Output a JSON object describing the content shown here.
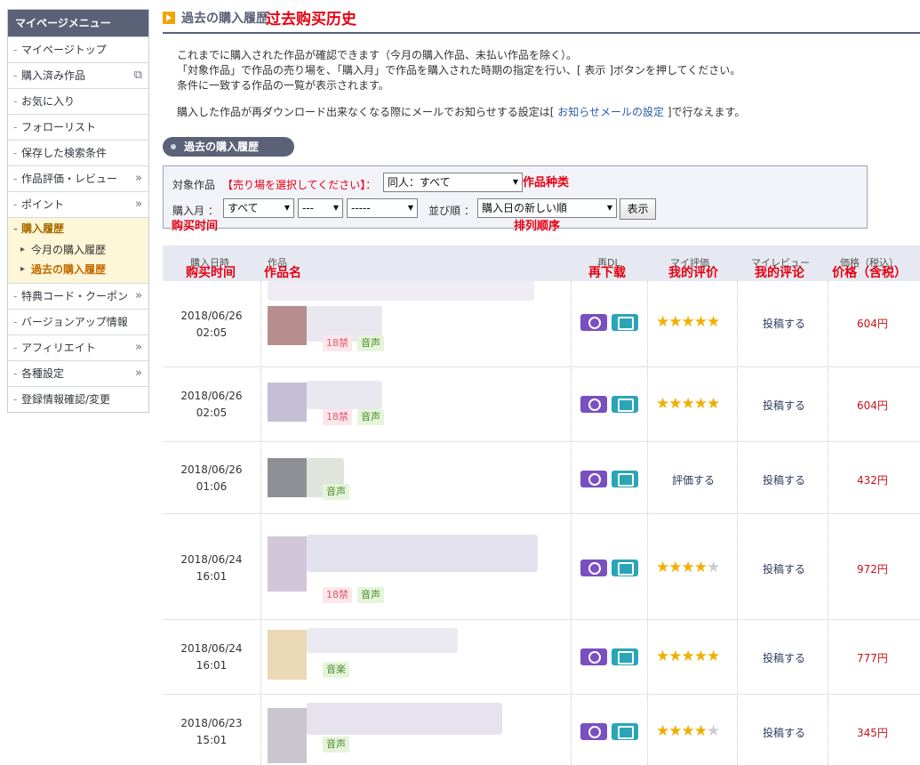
{
  "sidebar": {
    "header": "マイページメニュー",
    "items": [
      {
        "label": "マイページトップ",
        "right": ""
      },
      {
        "label": "購入済み作品",
        "right": "⧉"
      },
      {
        "label": "お気に入り",
        "right": ""
      },
      {
        "label": "フォローリスト",
        "right": ""
      },
      {
        "label": "保存した検索条件",
        "right": ""
      },
      {
        "label": "作品評価・レビュー",
        "right": "»"
      },
      {
        "label": "ポイント",
        "right": "»"
      },
      {
        "label": "購入履歴",
        "right": ""
      },
      {
        "label": "特典コード・クーポン",
        "right": "»"
      },
      {
        "label": "バージョンアップ情報",
        "right": ""
      },
      {
        "label": "アフィリエイト",
        "right": "»"
      },
      {
        "label": "各種設定",
        "right": "»"
      },
      {
        "label": "登録情報確認/変更",
        "right": ""
      }
    ],
    "sub_items": [
      "今月の購入履歴",
      "過去の購入履歴"
    ]
  },
  "page": {
    "title_jp": "過去の購入履歴",
    "title_cn": "过去购买历史",
    "intro": [
      "これまでに購入された作品が確認できます（今月の購入作品、未払い作品を除く）。",
      "「対象作品」で作品の売り場を、「購入月」で作品を購入された時期の指定を行い、[ 表示 ]ボタンを押してください。",
      "条件に一致する作品の一覧が表示されます。"
    ],
    "notice_pre": "購入した作品が再ダウンロード出来なくなる際にメールでお知らせする設定は[ ",
    "notice_link": "お知らせメールの設定",
    "notice_post": " ]で行なえます。",
    "section": "過去の購入履歴"
  },
  "filter": {
    "target_label": "対象作品",
    "target_hint": "【売り場を選択してください】：",
    "target_value": "同人：すべて",
    "month_label": "購入月 ：",
    "month_values": [
      "すべて",
      "---",
      "-----"
    ],
    "sort_label": "並び順 ：",
    "sort_value": "購入日の新しい順",
    "show_button": "表示"
  },
  "annotations": {
    "type": "作品种类",
    "time": "购买时间",
    "order": "排列顺序",
    "col_time": "购买时间",
    "col_name": "作品名",
    "col_dl": "再下载",
    "col_rating": "我的评价",
    "col_review": "我的评论",
    "col_price": "价格（含税）"
  },
  "table": {
    "headers": {
      "date": "購入日時",
      "work": "作品",
      "dl": "再DL",
      "rating": "マイ評価",
      "review": "マイレビュー",
      "price": "価格（税込）"
    },
    "rows": [
      {
        "date": "2018/06/26",
        "time": "02:05",
        "tags": [
          "18禁",
          "音声"
        ],
        "rating": "★★★★★",
        "rating_off": "",
        "rating_text": "",
        "review": "投稿する",
        "price": "604円"
      },
      {
        "date": "2018/06/26",
        "time": "02:05",
        "tags": [
          "18禁",
          "音声"
        ],
        "rating": "★★★★★",
        "rating_off": "",
        "rating_text": "",
        "review": "投稿する",
        "price": "604円"
      },
      {
        "date": "2018/06/26",
        "time": "01:06",
        "tags": [
          "音声"
        ],
        "rating": "",
        "rating_off": "",
        "rating_text": "評価する",
        "review": "投稿する",
        "price": "432円"
      },
      {
        "date": "2018/06/24",
        "time": "16:01",
        "tags": [
          "18禁",
          "音声"
        ],
        "rating": "★★★★",
        "rating_off": "★",
        "rating_text": "",
        "review": "投稿する",
        "price": "972円"
      },
      {
        "date": "2018/06/24",
        "time": "16:01",
        "tags": [
          "音楽"
        ],
        "rating": "★★★★★",
        "rating_off": "",
        "rating_text": "",
        "review": "投稿する",
        "price": "777円"
      },
      {
        "date": "2018/06/23",
        "time": "15:01",
        "tags": [
          "音声"
        ],
        "rating": "★★★★",
        "rating_off": "★",
        "rating_text": "",
        "review": "投稿する",
        "price": "345円"
      }
    ]
  }
}
